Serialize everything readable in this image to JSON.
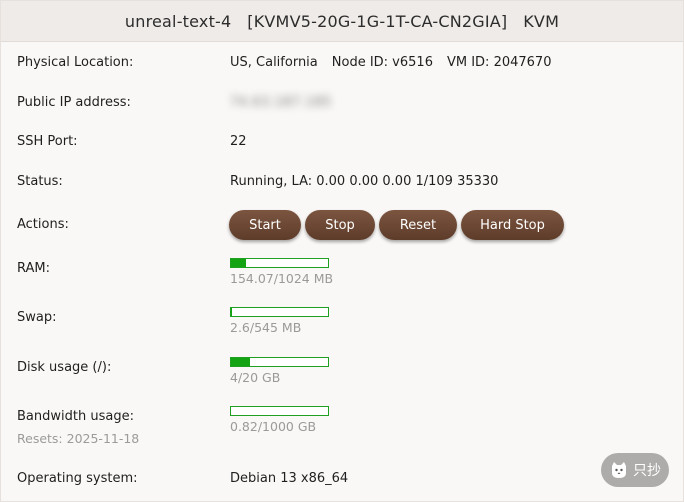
{
  "header": {
    "hostname": "unreal-text-4",
    "plan": "[KVMV5-20G-1G-1T-CA-CN2GIA]",
    "virt": "KVM"
  },
  "rows": {
    "location": {
      "label": "Physical Location:",
      "value": "US, California",
      "node": "Node ID: v6516",
      "vm": "VM ID: 2047670"
    },
    "ip": {
      "label": "Public IP address:",
      "value": "74.63.187.185"
    },
    "ssh": {
      "label": "SSH Port:",
      "value": "22"
    },
    "status": {
      "label": "Status:",
      "value": "Running, LA: 0.00 0.00 0.00 1/109 35330"
    },
    "actions": {
      "label": "Actions:",
      "start": "Start",
      "stop": "Stop",
      "reset": "Reset",
      "hard_stop": "Hard Stop"
    },
    "ram": {
      "label": "RAM:",
      "usage": "154.07/1024 MB",
      "fraction": 0.15
    },
    "swap": {
      "label": "Swap:",
      "usage": "2.6/545 MB",
      "fraction": 0.005
    },
    "disk": {
      "label": "Disk usage (/):",
      "usage": "4/20 GB",
      "fraction": 0.2
    },
    "bandwidth": {
      "label": "Bandwidth usage:",
      "resets": "Resets: 2025-11-18",
      "usage": "0.82/1000 GB",
      "fraction": 0.0008
    },
    "os": {
      "label": "Operating system:",
      "value": "Debian 13 x86_64"
    }
  },
  "badge": {
    "text": "只抄",
    "icon": "cat-icon"
  },
  "colors": {
    "button": "#6a4532",
    "bar": "#13a313",
    "header_bg": "#efebe8"
  }
}
